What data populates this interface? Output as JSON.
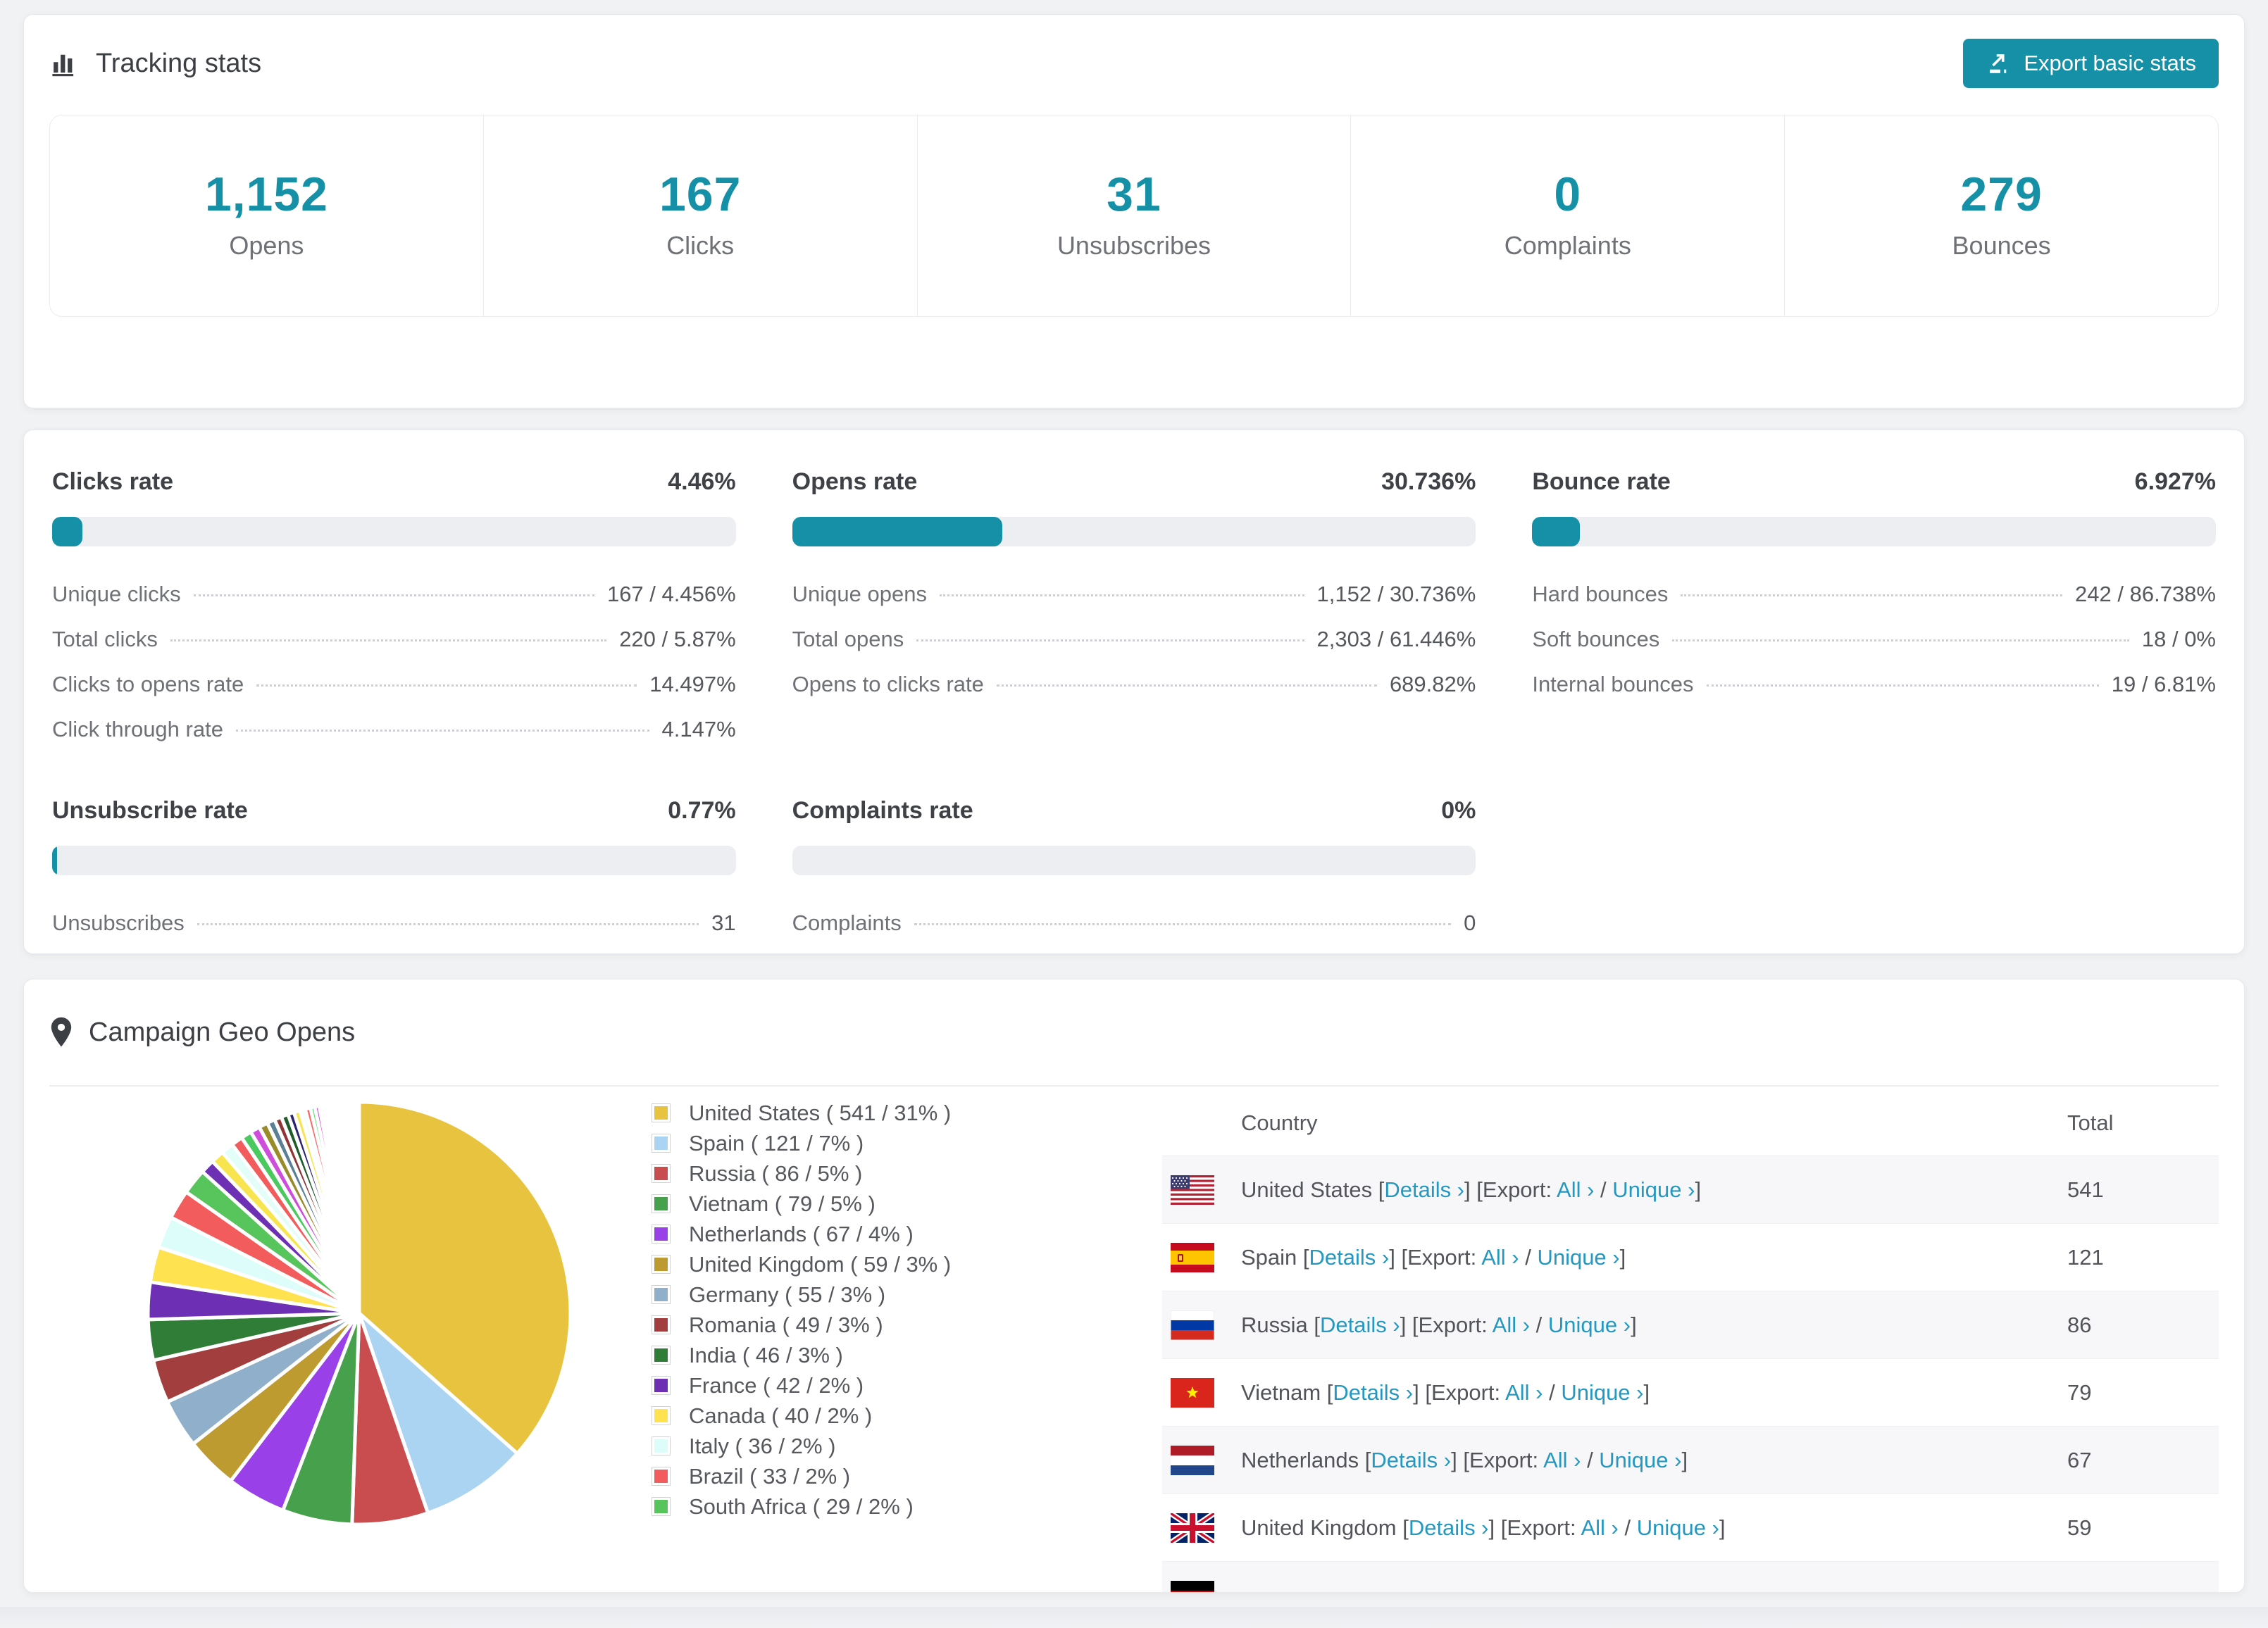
{
  "colors": {
    "accent": "#1590a6",
    "link": "#2598c0",
    "track": "#eceef2",
    "page_bg": "#f1f2f4"
  },
  "header": {
    "title": "Tracking stats",
    "icon": "bar-chart-icon",
    "export_label": "Export basic stats"
  },
  "summary_stats": [
    {
      "value": "1,152",
      "label": "Opens"
    },
    {
      "value": "167",
      "label": "Clicks"
    },
    {
      "value": "31",
      "label": "Unsubscribes"
    },
    {
      "value": "0",
      "label": "Complaints"
    },
    {
      "value": "279",
      "label": "Bounces"
    }
  ],
  "rates": [
    {
      "title": "Clicks rate",
      "value": "4.46%",
      "pct": 4.46,
      "rows": [
        {
          "label": "Unique clicks",
          "value": "167 / 4.456%"
        },
        {
          "label": "Total clicks",
          "value": "220 / 5.87%"
        },
        {
          "label": "Clicks to opens rate",
          "value": "14.497%"
        },
        {
          "label": "Click through rate",
          "value": "4.147%"
        }
      ]
    },
    {
      "title": "Opens rate",
      "value": "30.736%",
      "pct": 30.736,
      "rows": [
        {
          "label": "Unique opens",
          "value": "1,152 / 30.736%"
        },
        {
          "label": "Total opens",
          "value": "2,303 / 61.446%"
        },
        {
          "label": "Opens to clicks rate",
          "value": "689.82%"
        }
      ]
    },
    {
      "title": "Bounce rate",
      "value": "6.927%",
      "pct": 6.927,
      "rows": [
        {
          "label": "Hard bounces",
          "value": "242 / 86.738%"
        },
        {
          "label": "Soft bounces",
          "value": "18 / 0%"
        },
        {
          "label": "Internal bounces",
          "value": "19 / 6.81%"
        }
      ]
    },
    {
      "title": "Unsubscribe rate",
      "value": "0.77%",
      "pct": 0.77,
      "rows": [
        {
          "label": "Unsubscribes",
          "value": "31"
        }
      ]
    },
    {
      "title": "Complaints rate",
      "value": "0%",
      "pct": 0,
      "rows": [
        {
          "label": "Complaints",
          "value": "0"
        }
      ]
    }
  ],
  "geo": {
    "title": "Campaign Geo Opens",
    "icon": "map-pin-icon",
    "chart_data": {
      "type": "pie",
      "title": "Campaign Geo Opens",
      "labels_on_chart": false,
      "legend_position": "right",
      "labels": [
        "United States",
        "Spain",
        "Russia",
        "Vietnam",
        "Netherlands",
        "United Kingdom",
        "Germany",
        "Romania",
        "India",
        "France",
        "Canada",
        "Italy",
        "Brazil",
        "South Africa"
      ],
      "values": [
        541,
        121,
        86,
        79,
        67,
        59,
        55,
        49,
        46,
        42,
        40,
        36,
        33,
        29
      ],
      "percents": [
        31,
        7,
        5,
        5,
        4,
        3,
        3,
        3,
        3,
        2,
        2,
        2,
        2,
        2
      ],
      "colors": [
        "#e8c33f",
        "#abd3f2",
        "#c94d4f",
        "#47a04b",
        "#9a40e8",
        "#bd9b31",
        "#8fafca",
        "#a33e3e",
        "#2f7d36",
        "#6d2fb4",
        "#ffe24f",
        "#dcfdf9",
        "#f25c5c",
        "#57c55c"
      ],
      "others": {
        "description": "remaining small unlabeled country slices",
        "values": [
          16,
          15,
          14,
          13,
          12,
          11,
          10,
          9,
          8,
          8,
          7,
          7,
          6,
          6,
          5,
          5,
          4,
          4,
          4,
          3,
          3,
          3,
          3,
          2,
          2,
          2,
          2,
          2,
          2,
          1,
          1,
          1,
          1,
          1,
          1,
          1,
          1,
          1
        ],
        "colors": [
          "#6d2fb4",
          "#f7e44e",
          "#e3fdf9",
          "#f25c5c",
          "#49c95e",
          "#cf4ddb",
          "#9a8b2a",
          "#5b7f96",
          "#8f3535",
          "#1e5c2a",
          "#2a2472",
          "#f7e44e",
          "#eefffc",
          "#fa6a6a",
          "#52e06a",
          "#d24de0",
          "#b89a2e",
          "#7fa3c0",
          "#a03939",
          "#2f7d36",
          "#5a2fb4",
          "#e8c33f",
          "#9ae8b0",
          "#c8ae38",
          "#abd3f2",
          "#e05252",
          "#47a04b",
          "#9a40e8",
          "#f78fb5",
          "#4ab8c9",
          "#e8c33f",
          "#abd3f2",
          "#c94d4f",
          "#47a04b",
          "#9a40e8",
          "#bd9b31",
          "#8fafca",
          "#a33e3e"
        ]
      }
    },
    "table": {
      "columns": [
        "Country",
        "Total"
      ],
      "details_label": "Details",
      "export_label": "Export:",
      "all_label": "All",
      "unique_label": "Unique",
      "chevron": "›",
      "rows": [
        {
          "flag": "us",
          "country": "United States",
          "total": "541"
        },
        {
          "flag": "es",
          "country": "Spain",
          "total": "121"
        },
        {
          "flag": "ru",
          "country": "Russia",
          "total": "86"
        },
        {
          "flag": "vn",
          "country": "Vietnam",
          "total": "79"
        },
        {
          "flag": "nl",
          "country": "Netherlands",
          "total": "67"
        },
        {
          "flag": "gb",
          "country": "United Kingdom",
          "total": "59"
        },
        {
          "flag": "de",
          "country": "",
          "total": ""
        }
      ]
    }
  }
}
